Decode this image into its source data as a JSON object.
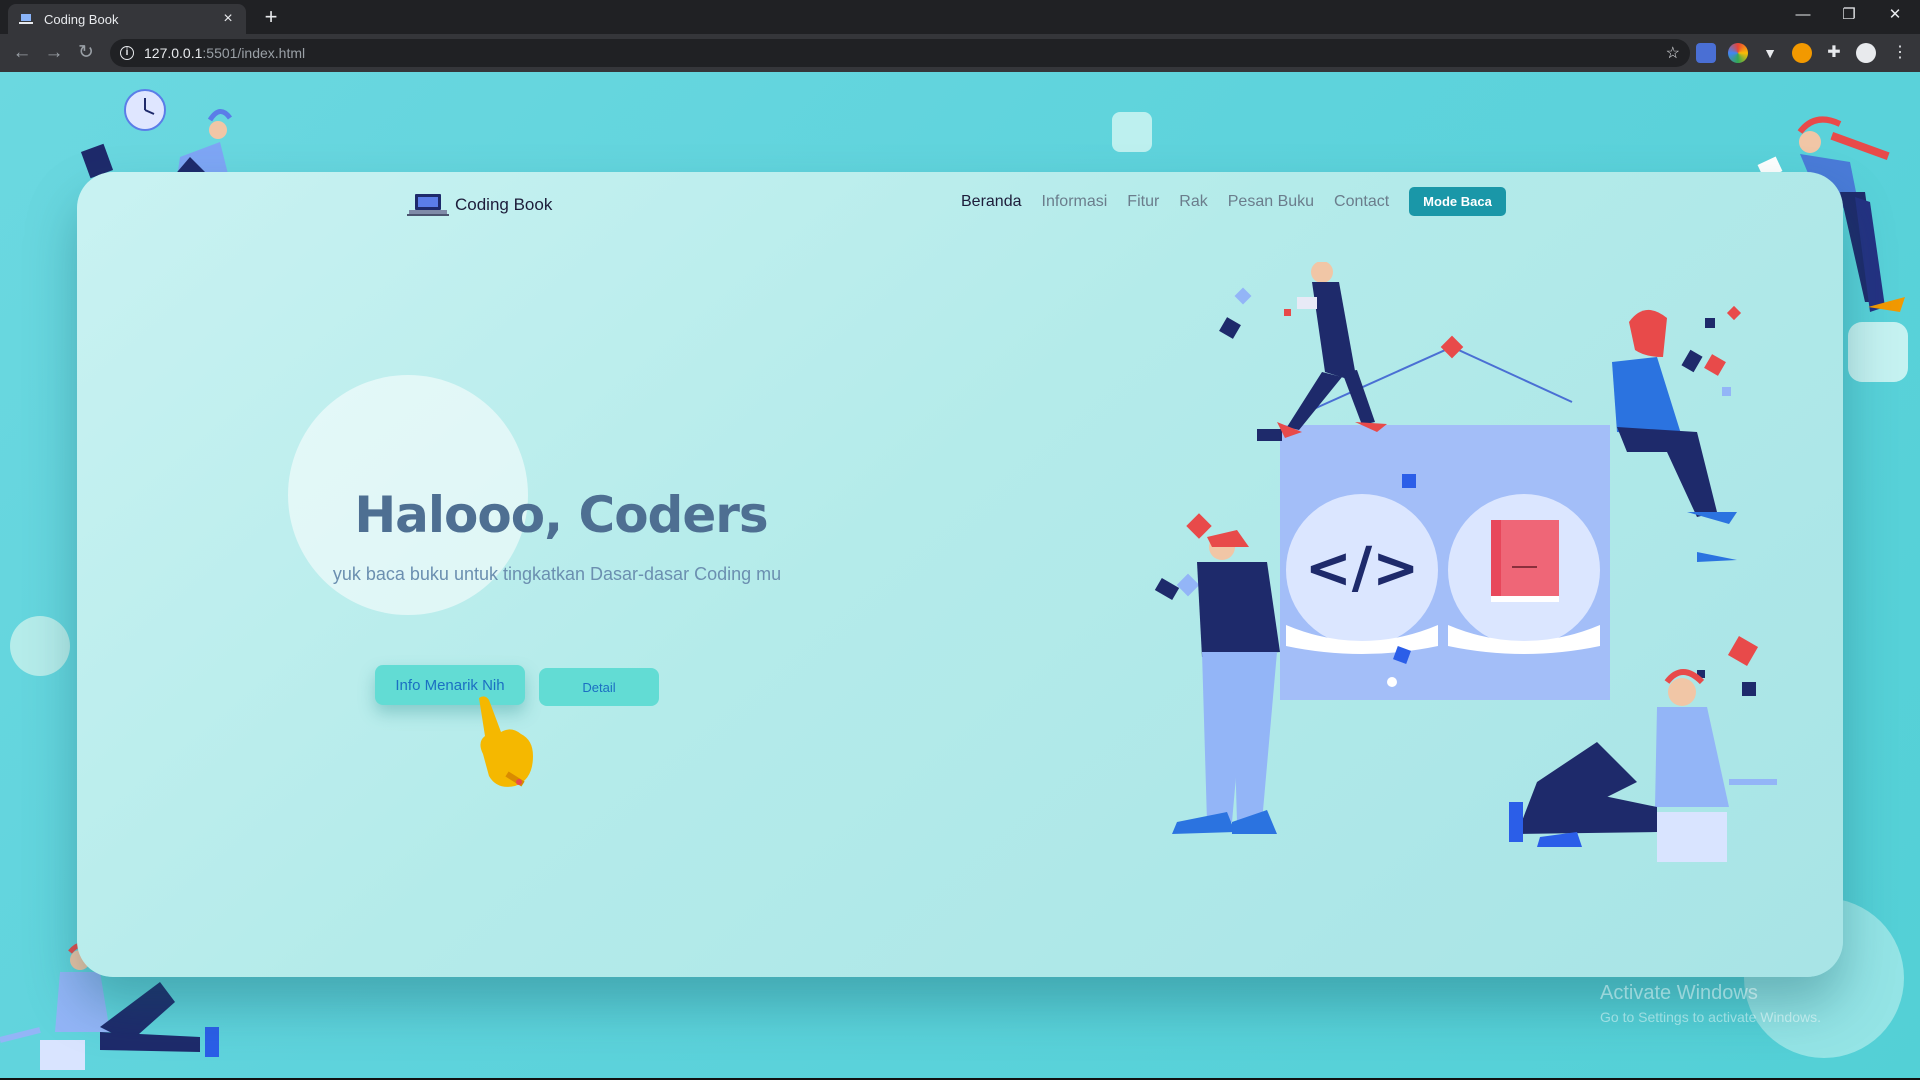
{
  "browser": {
    "tab_title": "Coding Book",
    "url_host": "127.0.0.1",
    "url_rest": ":5501/index.html",
    "new_tab": "+",
    "close_tab": "×"
  },
  "site": {
    "logo_text": "Coding Book",
    "nav": [
      "Beranda",
      "Informasi",
      "Fitur",
      "Rak",
      "Pesan Buku",
      "Contact"
    ],
    "mode_button": "Mode Baca"
  },
  "hero": {
    "title": "Halooo, Coders",
    "subtitle": "yuk baca buku untuk tingkatkan Dasar-dasar Coding mu",
    "primary_button": "Info Menarik Nih",
    "secondary_button": "Detail"
  },
  "illustration": {
    "code_symbol": "</>"
  },
  "watermark": {
    "title": "Activate Windows",
    "subtitle": "Go to Settings to activate Windows."
  },
  "colors": {
    "accent": "#1a97a8",
    "button": "#62dcd4",
    "title": "#4e6f92"
  }
}
